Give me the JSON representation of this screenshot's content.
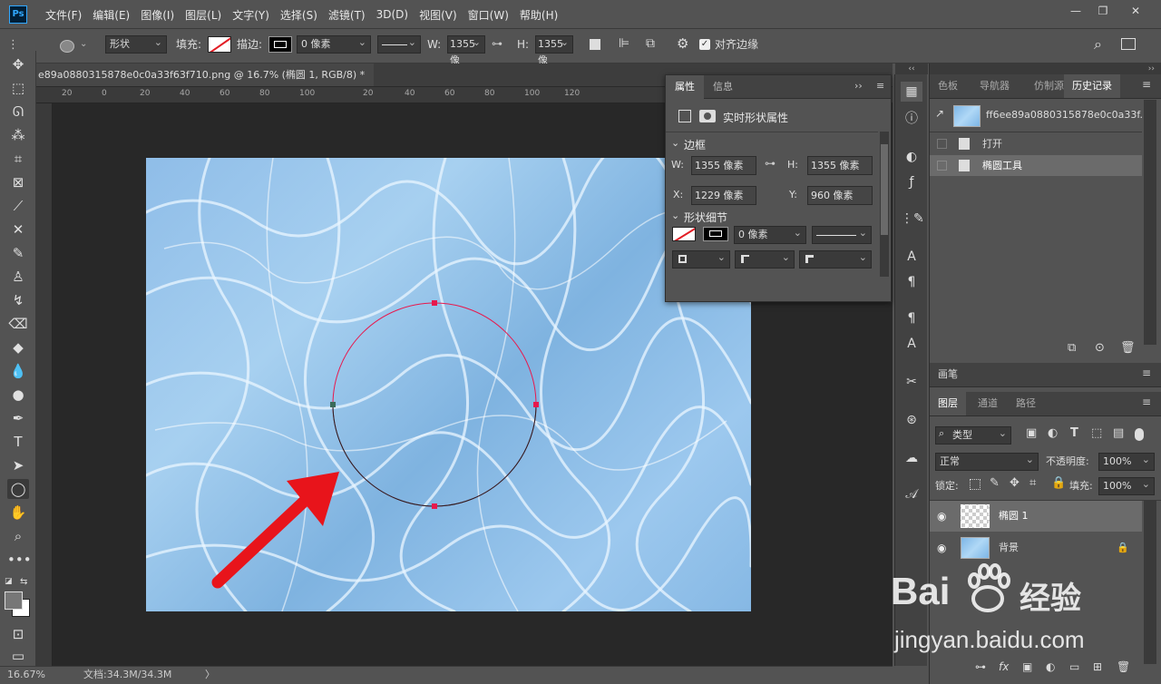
{
  "app": {
    "logo": "Ps",
    "min": "—",
    "restore": "❐",
    "close": "✕"
  },
  "menu": [
    "文件(F)",
    "编辑(E)",
    "图像(I)",
    "图层(L)",
    "文字(Y)",
    "选择(S)",
    "滤镜(T)",
    "3D(D)",
    "视图(V)",
    "窗口(W)",
    "帮助(H)"
  ],
  "options": {
    "mode": "形状",
    "fill_label": "填充:",
    "stroke_label": "描边:",
    "stroke_width": "0 像素",
    "w_label": "W:",
    "w_value": "1355 像",
    "h_label": "H:",
    "h_value": "1355 像",
    "align_edges": "对齐边缘"
  },
  "document": {
    "tab_title": "e89a0880315878e0c0a33f63f710.png @ 16.7% (椭圆 1, RGB/8) *",
    "tab_close": "×",
    "ruler": [
      "20",
      "0",
      "20",
      "40",
      "60",
      "80",
      "100",
      "20",
      "40",
      "60",
      "80",
      "100",
      "120"
    ]
  },
  "status": {
    "zoom": "16.67%",
    "doc": "文档:34.3M/34.3M",
    "arrow": "〉"
  },
  "properties": {
    "tabs": [
      "属性",
      "信息"
    ],
    "title": "实时形状属性",
    "section_bounds": "边框",
    "w_label": "W:",
    "w": "1355 像素",
    "h_label": "H:",
    "h": "1355 像素",
    "x_label": "X:",
    "x": "1229 像素",
    "y_label": "Y:",
    "y": "960 像素",
    "section_details": "形状细节",
    "stroke_width": "0 像素"
  },
  "history": {
    "tabs": [
      "色板",
      "导航器",
      "仿制源",
      "历史记录"
    ],
    "snapshot": "ff6ee89a0880315878e0c0a33f...",
    "items": [
      "打开",
      "椭圆工具"
    ]
  },
  "brush_tab": "画笔",
  "layers": {
    "tabs": [
      "图层",
      "通道",
      "路径"
    ],
    "kind": "类型",
    "blend": "正常",
    "opacity_label": "不透明度:",
    "opacity": "100%",
    "lock_label": "锁定:",
    "fill_label": "填充:",
    "fill": "100%",
    "items": [
      {
        "name": "椭圆 1"
      },
      {
        "name": "背景"
      }
    ]
  },
  "watermark": {
    "brand": "Bai",
    "brand2": "经验",
    "url": "jingyan.baidu.com"
  },
  "colors": {
    "accent": "#e8184d",
    "arrow": "#e8141b",
    "panel": "#535353",
    "canvas": "#282828"
  }
}
